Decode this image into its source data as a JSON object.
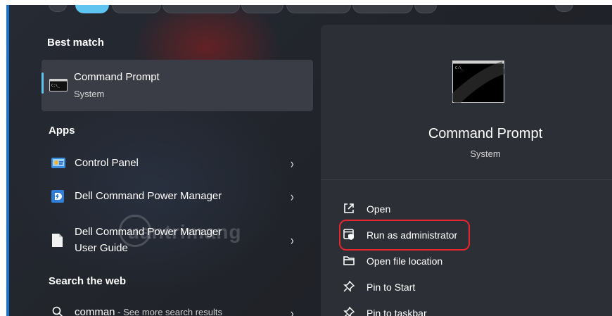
{
  "results": {
    "best_match_header": "Best match",
    "best_match": {
      "title": "Command Prompt",
      "subtitle": "System"
    },
    "apps_header": "Apps",
    "apps": [
      {
        "title": "Control Panel",
        "icon": "control-panel-icon"
      },
      {
        "title": "Dell Command Power Manager",
        "icon": "dell-command-icon"
      },
      {
        "title_line1": "Dell Command Power Manager",
        "title_line2": "User Guide",
        "icon": "document-icon"
      }
    ],
    "search_web_header": "Search the web",
    "web_result": {
      "query": "comman",
      "suffix": " - See more search results"
    }
  },
  "detail": {
    "title": "Command Prompt",
    "subtitle": "System",
    "actions": [
      {
        "label": "Open",
        "icon": "open-external-icon"
      },
      {
        "label": "Run as administrator",
        "icon": "shield-window-icon"
      },
      {
        "label": "Open file location",
        "icon": "folder-icon"
      },
      {
        "label": "Pin to Start",
        "icon": "pin-icon"
      },
      {
        "label": "Pin to taskbar",
        "icon": "pin-icon"
      }
    ]
  },
  "watermark": "uantrimang",
  "colors": {
    "accent": "#5fc4f0",
    "highlight": "#e5262d",
    "panel": "#2c2f36"
  }
}
